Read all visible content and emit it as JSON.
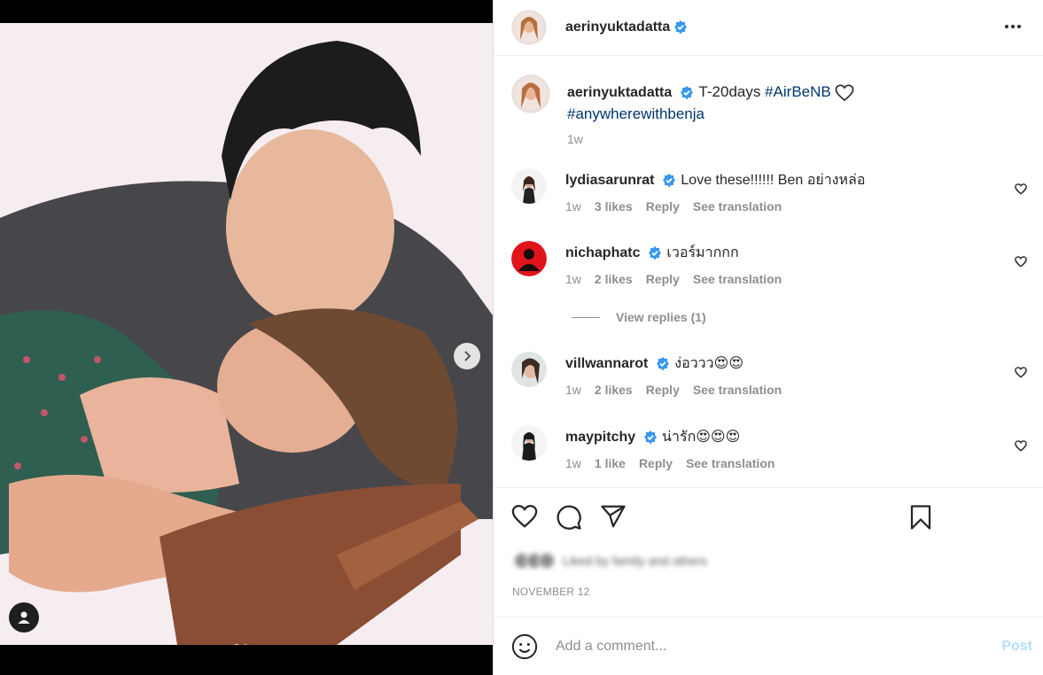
{
  "post": {
    "author": "aerinyuktadatta",
    "carousel": {
      "current": 1,
      "total": 2
    }
  },
  "caption": {
    "author": "aerinyuktadatta",
    "text": "T-20days",
    "hashtags": [
      "#AirBeNB",
      "#anywherewithbenja"
    ],
    "time": "1w"
  },
  "comments": [
    {
      "user": "lydiasarunrat",
      "text": "Love these!!!!!! Ben อย่างหล่อ",
      "time": "1w",
      "likes": "3 likes",
      "reply": "Reply",
      "translate": "See translation"
    },
    {
      "user": "nichaphatc",
      "text": "เวอร์มากกก",
      "time": "1w",
      "likes": "2 likes",
      "reply": "Reply",
      "translate": "See translation"
    },
    {
      "user": "villwannarot",
      "text": "ง่อววว😍😍",
      "time": "1w",
      "likes": "2 likes",
      "reply": "Reply",
      "translate": "See translation"
    },
    {
      "user": "maypitchy",
      "text": "น่ารัก😍😍😍",
      "time": "1w",
      "likes": "1 like",
      "reply": "Reply",
      "translate": "See translation"
    }
  ],
  "view_replies": "View replies (1)",
  "liked_by": "Liked by family and others",
  "date": "NOVEMBER 12",
  "add_comment": {
    "placeholder": "Add a comment...",
    "post_label": "Post"
  },
  "colors": {
    "hashtag": "#00376b",
    "verified": "#3897f0",
    "post_disabled": "#b2dffc",
    "muted": "#8e8e8e"
  },
  "icons": [
    "verified-icon",
    "more-icon",
    "heart-icon",
    "comment-icon",
    "share-icon",
    "bookmark-icon",
    "emoji-icon",
    "chevron-right-icon",
    "user-tag-icon"
  ]
}
